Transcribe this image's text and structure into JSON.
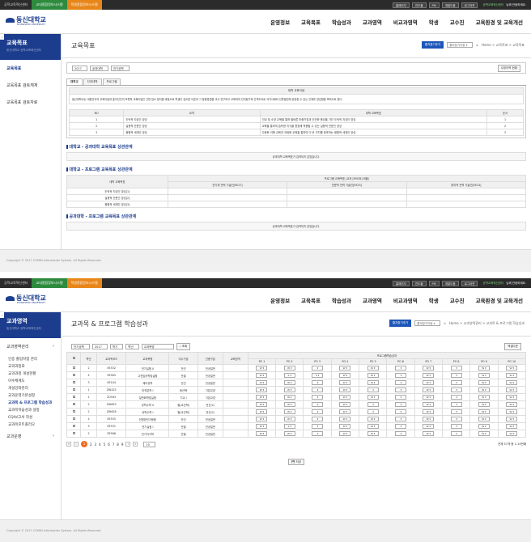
{
  "topbar": {
    "tab1": "공학교육혁신센터",
    "tab2": "교내종합정보시스템",
    "tab3": "학생종합정보시스템",
    "ctl1": "홈페이지",
    "ctl2": "진도율",
    "ctl3": "PM",
    "ctl4": "개발도움",
    "ctl5": "로그아웃",
    "lnk": "공학교육혁신센터",
    "welcome": "님께 안녕하세요."
  },
  "logo": {
    "k": "동신대학교",
    "e": "DONGSHIN UNIVERSITY"
  },
  "gnb": [
    "운영정보",
    "교육목표",
    "학습성과",
    "교과영역",
    "비교과영역",
    "학생",
    "교수진",
    "교육환경 및 교육개선"
  ],
  "s1": {
    "lnb": {
      "title": "교육목표",
      "subtitle": "동신대학교 공학교육혁신센터",
      "items": [
        "교육목표",
        "교육목표 검토체계",
        "교육목표 검토자료"
      ]
    },
    "page_title": "교육목표",
    "btn_fav": "즐겨찾기추가",
    "fav_select": "즐겨찾기이동 ▾",
    "crumb": "Home > 교육목표 > 교육목표",
    "filters": {
      "year": "2017",
      "college": "공과대학",
      "dept": "전기공학",
      "btn": "수정이력 현황"
    },
    "tabs": [
      "대학교",
      "단과대학",
      "프로그램"
    ],
    "ideal_cap": "대학 교육이념",
    "ideal_text": "동신대학교는 대한민국의 교육이념과 홍익인간의 보편적 교육이념인 근면·검소·정직을 바탕으로 학생이 심오한 이론과 그 응용방법을 교수·연구하고 교육하여 진리탐구와 인격도야로 국가사회와 인류발전에 공헌할 수 있는 인재를 양성함을 목적으로 한다.",
    "goals_head": [
      "NO",
      "요약",
      "대학 교육목표",
      "순서"
    ],
    "goals": [
      {
        "no": "1",
        "sum": "도덕적 지성인 양성",
        "txt": "인성 및 소양 교육을 통한 올바른 마음가짐과 건전한 품성을 가진 도덕적 지성인 양성",
        "ord": "1"
      },
      {
        "no": "2",
        "sum": "실용적 전문인 양성",
        "txt": "교육을 통하여 습득한 지식을 현장에 적용할 수 있는 실용적 전문인 양성",
        "ord": "2"
      },
      {
        "no": "3",
        "sum": "융합적 세계인 양성",
        "txt": "다문화 이해 교육과 국제화 교육을 통하여 더 큰 가치를 창조하는 융합적 세계인 양성",
        "ord": "3"
      }
    ],
    "sec1": "대학교 - 공과대학 교육목표 상관관계",
    "empty1": "공과대학 교육목표가 입력되지 않았습니다.",
    "sec2": "대학교 - 프로그램 교육목표 상관관계",
    "rel_head_left": "대학 교육목표",
    "rel_head_top": "프로그램 교육목표 (교과 [EMCB] 비율)",
    "rel_cols": [
      "전기계 전력 기술인[EE27]",
      "전문적 전력 기술인[EE25]",
      "창의적 전력 기술인[EE24]"
    ],
    "rel_rows": [
      "도덕적 지성인 양성[1]",
      "실용적 전문인 양성[2]",
      "융합적 세계인 양성[3]"
    ],
    "sec3": "공과대학 - 프로그램 교육목표 상관관계",
    "empty3": "공과대학 교육목표가 입력되지 않았습니다.",
    "copyright": "Copyright © 2017 COMIN Information System. All Rights Reserved."
  },
  "s2": {
    "lnb": {
      "title": "교과영역",
      "subtitle": "동신대학교 공학교육혁신센터",
      "menu1": "교과영역관리",
      "subs": [
        "인증 졸업학점 관리",
        "교과과정표",
        "교과과정 개설현황",
        "이수체계도",
        "개설강좌관리",
        "교과운영기본설정",
        "교과목 & 프로그램 학습성과",
        "교과목학습성과 설정",
        "CQI보고서 작성",
        "교과목포트폴리오"
      ],
      "menu2": "교과운영"
    },
    "page_title": "교과목 & 프로그램 학습성과",
    "btn_fav": "즐겨찾기추가",
    "fav_select": "즐겨찾기이동 ▾",
    "crumb": "Home > 교과영역관리 > 교과목 & 프로그램 학습성과",
    "filters": {
      "dept": "전기공학",
      "year": "2017",
      "term": "학기",
      "grade": "학년",
      "search": "교과목명",
      "btn": "조회",
      "excel": "엑셀다운"
    },
    "head": [
      "학년",
      "교과목코드",
      "교과목명",
      "이수구분",
      "인증구분",
      "교육영역"
    ],
    "po_cap": "프로그램학습성과",
    "po": [
      "PO 1",
      "PO 2",
      "PO 3",
      "PO 4",
      "PO 5",
      "PO 6",
      "PO 7",
      "PO 8",
      "PO 9",
      "PO 10"
    ],
    "rows": [
      {
        "y": "2",
        "code": "EE532",
        "name": "전기실험 II",
        "t": "전선",
        "c": "전공일반",
        "v": [
          "W",
          "W",
          "",
          "W",
          "W",
          "",
          "W",
          "",
          "W",
          "W"
        ]
      },
      {
        "y": "4",
        "code": "EE905",
        "name": "고전압공학및실험",
        "t": "전필",
        "c": "전공일반",
        "v": [
          "W",
          "S",
          "S",
          "W",
          "W",
          "",
          "W",
          "",
          "W",
          "W"
        ]
      },
      {
        "y": "3",
        "code": "EE104",
        "name": "제어공학",
        "t": "전선",
        "c": "전공일반",
        "v": [
          "W",
          "W",
          "",
          "W",
          "W",
          "",
          "W",
          "",
          "W",
          "W"
        ]
      },
      {
        "y": "1",
        "code": "ZW425",
        "name": "미적분학 I",
        "t": "동선택",
        "c": "기본교양",
        "v": [
          "W",
          "W",
          "",
          "W",
          "",
          "",
          "W",
          "",
          "W",
          "W"
        ]
      },
      {
        "y": "1",
        "code": "ZO943",
        "name": "일반화학및실험",
        "t": "기교 I",
        "c": "기본교양",
        "v": [
          "W",
          "W",
          "",
          "W",
          "W",
          "",
          "W",
          "",
          "W",
          "W"
        ]
      },
      {
        "y": "2",
        "code": "ZW629",
        "name": "공학수학 II",
        "t": "필(교선택)",
        "c": "전선(C)",
        "v": [
          "W",
          "W",
          "",
          "W",
          "",
          "",
          "W",
          "",
          "W",
          "W"
        ]
      },
      {
        "y": "2",
        "code": "ZW628",
        "name": "공학수학 I",
        "t": "필(교선택)",
        "c": "전선(C)",
        "v": [
          "W",
          "W",
          "",
          "W",
          "",
          "",
          "W",
          "",
          "W",
          "W"
        ]
      },
      {
        "y": "4",
        "code": "EE535",
        "name": "전원방전기응용",
        "t": "전선",
        "c": "전공일반",
        "v": [
          "W",
          "W",
          "",
          "W",
          "W",
          "",
          "W",
          "",
          "W",
          "W"
        ]
      },
      {
        "y": "3",
        "code": "EE531",
        "name": "전기실험 I",
        "t": "전필",
        "c": "전공일반",
        "v": [
          "W",
          "S",
          "",
          "W",
          "W",
          "",
          "W",
          "",
          "W",
          "W"
        ]
      },
      {
        "y": "2",
        "code": "EE906",
        "name": "전기자기학",
        "t": "전필",
        "c": "전공일반",
        "v": [
          "W",
          "W",
          "",
          "W",
          "W",
          "",
          "W",
          "",
          "W",
          "W"
        ]
      }
    ],
    "pages": [
      "1",
      "2",
      "3",
      "4",
      "5",
      "6",
      "7",
      "8",
      "9"
    ],
    "page_size": "10",
    "total": "전체 57개 중 1-10번째",
    "save": "저장",
    "copyright": "Copyright © 2017 COMIN Information System. All Rights Reserved."
  },
  "colors": {
    "navy": "#1c3c8d",
    "green": "#2e8b3e",
    "orange": "#e8861a",
    "accent": "#f26b1d"
  }
}
